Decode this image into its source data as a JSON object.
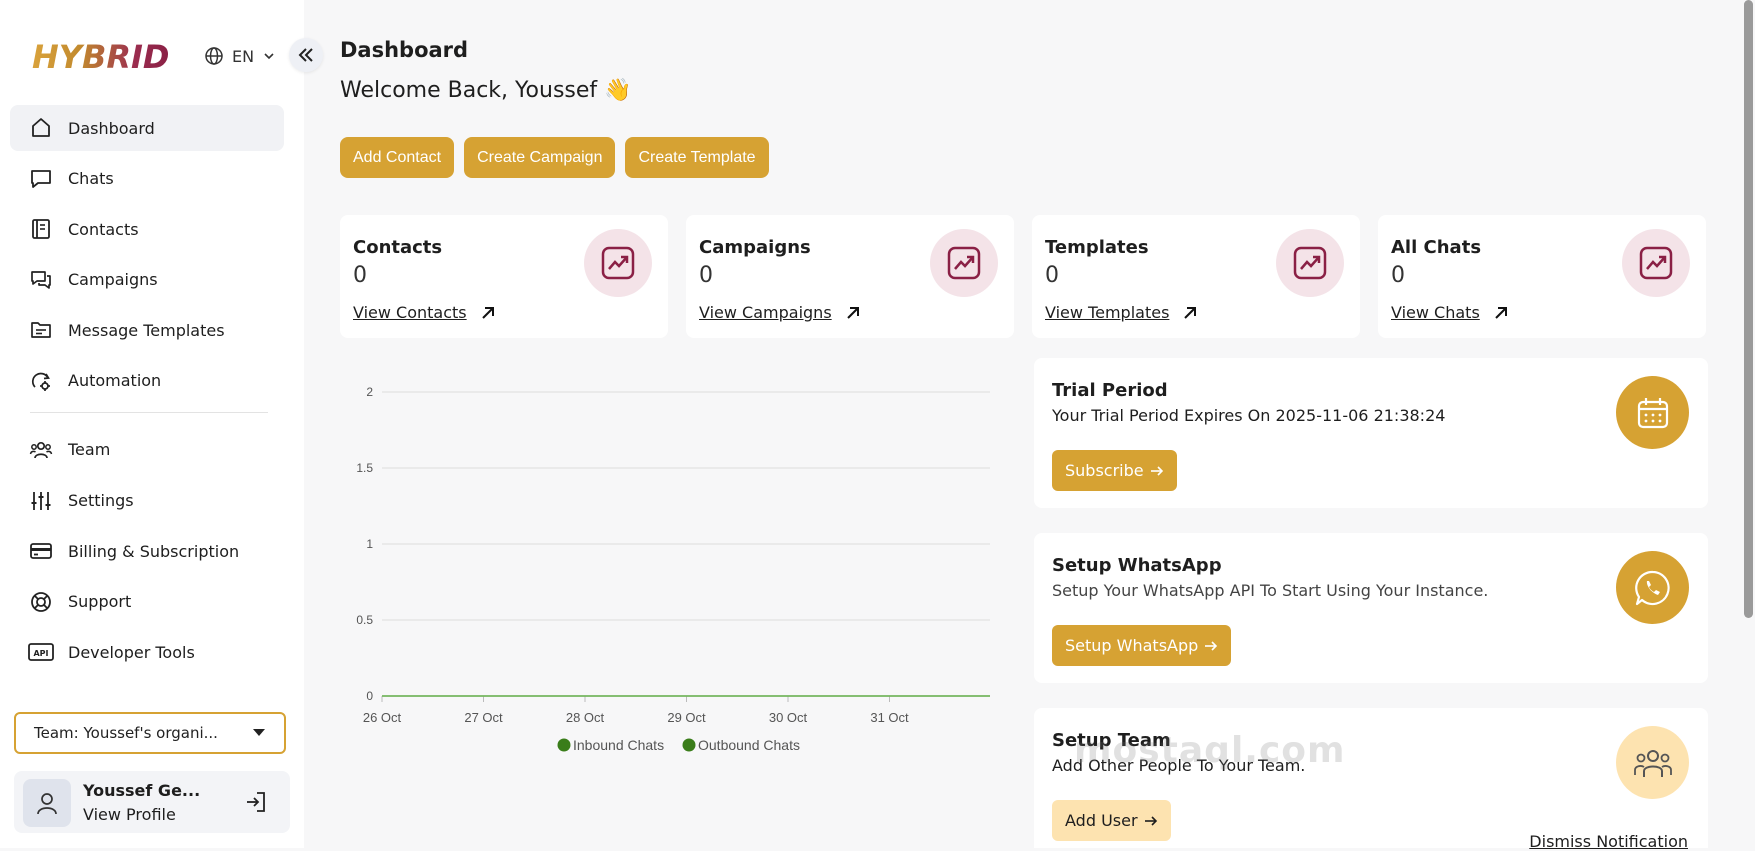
{
  "app": {
    "logo_text": "HYBRID",
    "language": "EN"
  },
  "sidebar": {
    "items": [
      {
        "label": "Dashboard",
        "icon": "home-icon",
        "active": true
      },
      {
        "label": "Chats",
        "icon": "chat-bubble-icon"
      },
      {
        "label": "Contacts",
        "icon": "contact-book-icon"
      },
      {
        "label": "Campaigns",
        "icon": "campaigns-icon"
      },
      {
        "label": "Message Templates",
        "icon": "folder-template-icon"
      },
      {
        "label": "Automation",
        "icon": "automation-icon"
      },
      {
        "label": "Team",
        "icon": "team-icon"
      },
      {
        "label": "Settings",
        "icon": "sliders-icon"
      },
      {
        "label": "Billing & Subscription",
        "icon": "credit-card-icon"
      },
      {
        "label": "Support",
        "icon": "lifebuoy-icon"
      },
      {
        "label": "Developer Tools",
        "icon": "api-icon"
      }
    ],
    "team_select": "Team: Youssef's organi...",
    "profile": {
      "name": "Youssef Ge...",
      "link": "View Profile"
    }
  },
  "main": {
    "title": "Dashboard",
    "welcome": "Welcome Back, Youssef 👋",
    "actions": [
      "Add Contact",
      "Create Campaign",
      "Create Template"
    ],
    "cards": [
      {
        "title": "Contacts",
        "value": "0",
        "link": "View Contacts"
      },
      {
        "title": "Campaigns",
        "value": "0",
        "link": "View Campaigns"
      },
      {
        "title": "Templates",
        "value": "0",
        "link": "View Templates"
      },
      {
        "title": "All Chats",
        "value": "0",
        "link": "View Chats"
      }
    ],
    "trial": {
      "title": "Trial Period",
      "text": "Your Trial Period Expires On 2025-11-06 21:38:24",
      "button": "Subscribe"
    },
    "whatsapp": {
      "title": "Setup WhatsApp",
      "text": "Setup Your WhatsApp API To Start Using Your Instance.",
      "button": "Setup WhatsApp"
    },
    "team": {
      "title": "Setup Team",
      "text": "Add Other People To Your Team.",
      "button": "Add User",
      "dismiss": "Dismiss Notification"
    },
    "watermark": "mostaql.com"
  },
  "colors": {
    "accent": "#d6a233",
    "accent_light": "#fde3b0",
    "brand_maroon": "#8a2045",
    "series_green": "#3a7d1a"
  },
  "chart_data": {
    "type": "line",
    "categories": [
      "26 Oct",
      "27 Oct",
      "28 Oct",
      "29 Oct",
      "30 Oct",
      "31 Oct"
    ],
    "series": [
      {
        "name": "Inbound Chats",
        "values": [
          0,
          0,
          0,
          0,
          0,
          0
        ]
      },
      {
        "name": "Outbound Chats",
        "values": [
          0,
          0,
          0,
          0,
          0,
          0
        ]
      }
    ],
    "y_ticks": [
      "0",
      "0.5",
      "1",
      "1.5",
      "2"
    ],
    "ylim": [
      0,
      2
    ],
    "grid": true,
    "legend": "bottom"
  }
}
